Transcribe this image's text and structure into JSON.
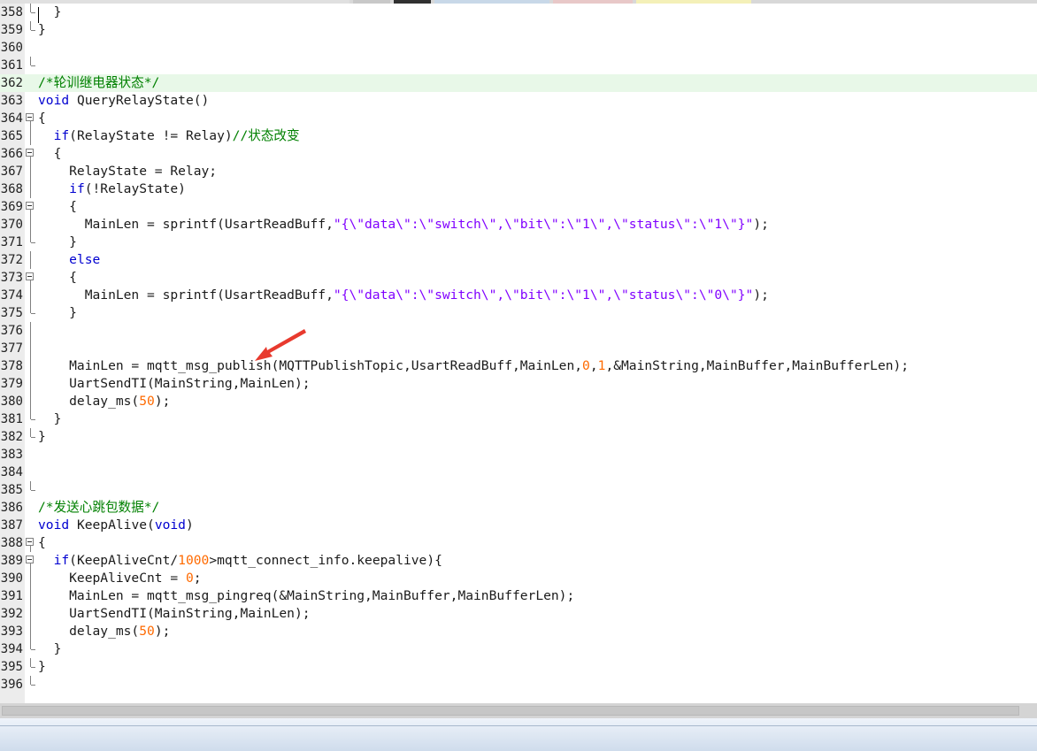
{
  "ui": {
    "tab_colors": [
      "#e0e0e0",
      "#c8c8c8",
      "#303030",
      "#c8d8e8",
      "#e8c8c8",
      "#f4f0b8"
    ]
  },
  "editor": {
    "lines": [
      {
        "n": "358",
        "fold": "end",
        "parts": [
          [
            "  }",
            "p"
          ]
        ]
      },
      {
        "n": "359",
        "fold": "end",
        "parts": [
          [
            "}",
            "p"
          ]
        ]
      },
      {
        "n": "360",
        "fold": "",
        "parts": []
      },
      {
        "n": "361",
        "fold": "end",
        "parts": []
      },
      {
        "n": "362",
        "fold": "",
        "hl": true,
        "caret": true,
        "parts": [
          [
            "/*轮训继电器状态*/",
            "cm"
          ]
        ]
      },
      {
        "n": "363",
        "fold": "",
        "parts": [
          [
            "void",
            "kw"
          ],
          [
            " QueryRelayState()",
            "p"
          ]
        ]
      },
      {
        "n": "364",
        "fold": "box",
        "parts": [
          [
            "{",
            "p"
          ]
        ]
      },
      {
        "n": "365",
        "fold": "line",
        "parts": [
          [
            "  ",
            "p"
          ],
          [
            "if",
            "kw"
          ],
          [
            "(RelayState != Relay)",
            "p"
          ],
          [
            "//状态改变",
            "cm"
          ]
        ]
      },
      {
        "n": "366",
        "fold": "box",
        "parts": [
          [
            "  {",
            "p"
          ]
        ]
      },
      {
        "n": "367",
        "fold": "line",
        "parts": [
          [
            "    RelayState = Relay;",
            "p"
          ]
        ]
      },
      {
        "n": "368",
        "fold": "line",
        "parts": [
          [
            "    ",
            "p"
          ],
          [
            "if",
            "kw"
          ],
          [
            "(!RelayState)",
            "p"
          ]
        ]
      },
      {
        "n": "369",
        "fold": "box",
        "parts": [
          [
            "    {",
            "p"
          ]
        ]
      },
      {
        "n": "370",
        "fold": "line",
        "parts": [
          [
            "      MainLen = sprintf(UsartReadBuff,",
            "p"
          ],
          [
            "\"{\\\"data\\\":\\\"switch\\\",\\\"bit\\\":\\\"1\\\",\\\"status\\\":\\\"1\\\"}\"",
            "st"
          ],
          [
            ");",
            "p"
          ]
        ]
      },
      {
        "n": "371",
        "fold": "end",
        "parts": [
          [
            "    }",
            "p"
          ]
        ]
      },
      {
        "n": "372",
        "fold": "line",
        "parts": [
          [
            "    ",
            "p"
          ],
          [
            "else",
            "kw"
          ]
        ]
      },
      {
        "n": "373",
        "fold": "box",
        "parts": [
          [
            "    {",
            "p"
          ]
        ]
      },
      {
        "n": "374",
        "fold": "line",
        "parts": [
          [
            "      MainLen = sprintf(UsartReadBuff,",
            "p"
          ],
          [
            "\"{\\\"data\\\":\\\"switch\\\",\\\"bit\\\":\\\"1\\\",\\\"status\\\":\\\"0\\\"}\"",
            "st"
          ],
          [
            ");",
            "p"
          ]
        ]
      },
      {
        "n": "375",
        "fold": "end",
        "parts": [
          [
            "    }",
            "p"
          ]
        ]
      },
      {
        "n": "376",
        "fold": "line",
        "parts": []
      },
      {
        "n": "377",
        "fold": "line",
        "parts": []
      },
      {
        "n": "378",
        "fold": "line",
        "parts": [
          [
            "    MainLen = mqtt_msg_publish(MQTTPublishTopic,UsartReadBuff,MainLen,",
            "p"
          ],
          [
            "0",
            "nm"
          ],
          [
            ",",
            "p"
          ],
          [
            "1",
            "nm"
          ],
          [
            ",&MainString,MainBuffer,MainBufferLen);",
            "p"
          ]
        ]
      },
      {
        "n": "379",
        "fold": "line",
        "parts": [
          [
            "    UartSendTI(MainString,MainLen);",
            "p"
          ]
        ]
      },
      {
        "n": "380",
        "fold": "line",
        "parts": [
          [
            "    delay_ms(",
            "p"
          ],
          [
            "50",
            "nm"
          ],
          [
            ");",
            "p"
          ]
        ]
      },
      {
        "n": "381",
        "fold": "end",
        "parts": [
          [
            "  }",
            "p"
          ]
        ]
      },
      {
        "n": "382",
        "fold": "end",
        "parts": [
          [
            "}",
            "p"
          ]
        ]
      },
      {
        "n": "383",
        "fold": "",
        "parts": []
      },
      {
        "n": "384",
        "fold": "",
        "parts": []
      },
      {
        "n": "385",
        "fold": "end",
        "parts": []
      },
      {
        "n": "386",
        "fold": "",
        "parts": [
          [
            "/*发送心跳包数据*/",
            "cm"
          ]
        ]
      },
      {
        "n": "387",
        "fold": "",
        "parts": [
          [
            "void",
            "kw"
          ],
          [
            " KeepAlive(",
            "p"
          ],
          [
            "void",
            "kw"
          ],
          [
            ")",
            "p"
          ]
        ]
      },
      {
        "n": "388",
        "fold": "box",
        "parts": [
          [
            "{",
            "p"
          ]
        ]
      },
      {
        "n": "389",
        "fold": "box",
        "parts": [
          [
            "  ",
            "p"
          ],
          [
            "if",
            "kw"
          ],
          [
            "(KeepAliveCnt/",
            "p"
          ],
          [
            "1000",
            "nm"
          ],
          [
            ">mqtt_connect_info.keepalive){",
            "p"
          ]
        ]
      },
      {
        "n": "390",
        "fold": "line",
        "parts": [
          [
            "    KeepAliveCnt = ",
            "p"
          ],
          [
            "0",
            "nm"
          ],
          [
            ";",
            "p"
          ]
        ]
      },
      {
        "n": "391",
        "fold": "line",
        "parts": [
          [
            "    MainLen = mqtt_msg_pingreq(&MainString,MainBuffer,MainBufferLen);",
            "p"
          ]
        ]
      },
      {
        "n": "392",
        "fold": "line",
        "parts": [
          [
            "    UartSendTI(MainString,MainLen);",
            "p"
          ]
        ]
      },
      {
        "n": "393",
        "fold": "line",
        "parts": [
          [
            "    delay_ms(",
            "p"
          ],
          [
            "50",
            "nm"
          ],
          [
            ");",
            "p"
          ]
        ]
      },
      {
        "n": "394",
        "fold": "end",
        "parts": [
          [
            "  }",
            "p"
          ]
        ]
      },
      {
        "n": "395",
        "fold": "end",
        "parts": [
          [
            "}",
            "p"
          ]
        ]
      },
      {
        "n": "396",
        "fold": "end",
        "parts": []
      }
    ]
  },
  "annotation": {
    "icon": "red-arrow-icon",
    "color": "#e83a2e",
    "points_to_line": "378"
  }
}
